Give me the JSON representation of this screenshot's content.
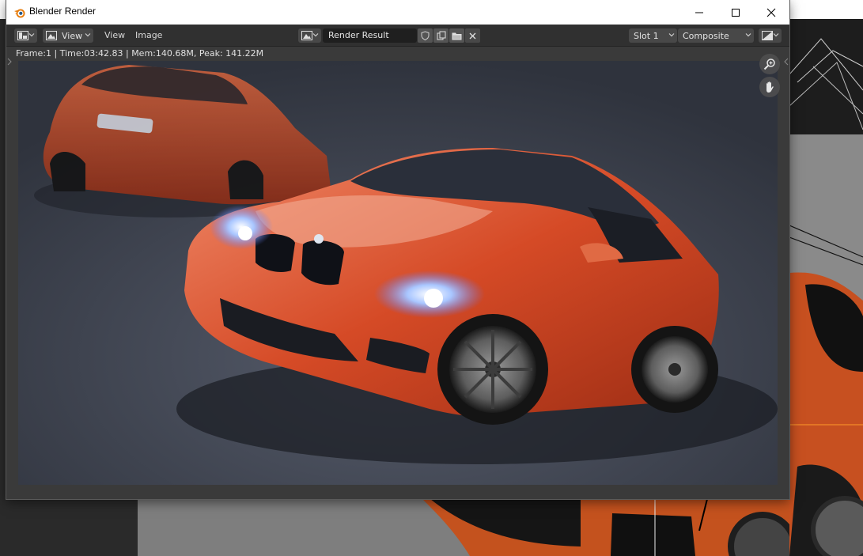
{
  "window": {
    "title": "Blender Render",
    "controls": [
      "minimize",
      "maximize",
      "close"
    ]
  },
  "header": {
    "editor_type_icon": "image-editor-icon",
    "view_mode_icon": "image-icon",
    "view_dropdown": "View",
    "menus": [
      "View",
      "Image"
    ],
    "image_browse_icon": "image-browse-icon",
    "image_name": "Render Result",
    "action_icons": [
      "shield-icon",
      "copy-icon",
      "folder-icon",
      "close-icon"
    ],
    "slot": "Slot 1",
    "layer": "Composite",
    "display_channels_icon": "display-channels-icon"
  },
  "info": {
    "text": "Frame:1 | Time:03:42.83 | Mem:140.68M, Peak: 141.22M"
  },
  "nav": {
    "zoom_icon": "zoom-icon",
    "pan_icon": "hand-icon"
  },
  "render": {
    "subject": "two orange BMW 1 Series coupes",
    "body_color": "#d9532b",
    "background_color": "#3d424f"
  }
}
